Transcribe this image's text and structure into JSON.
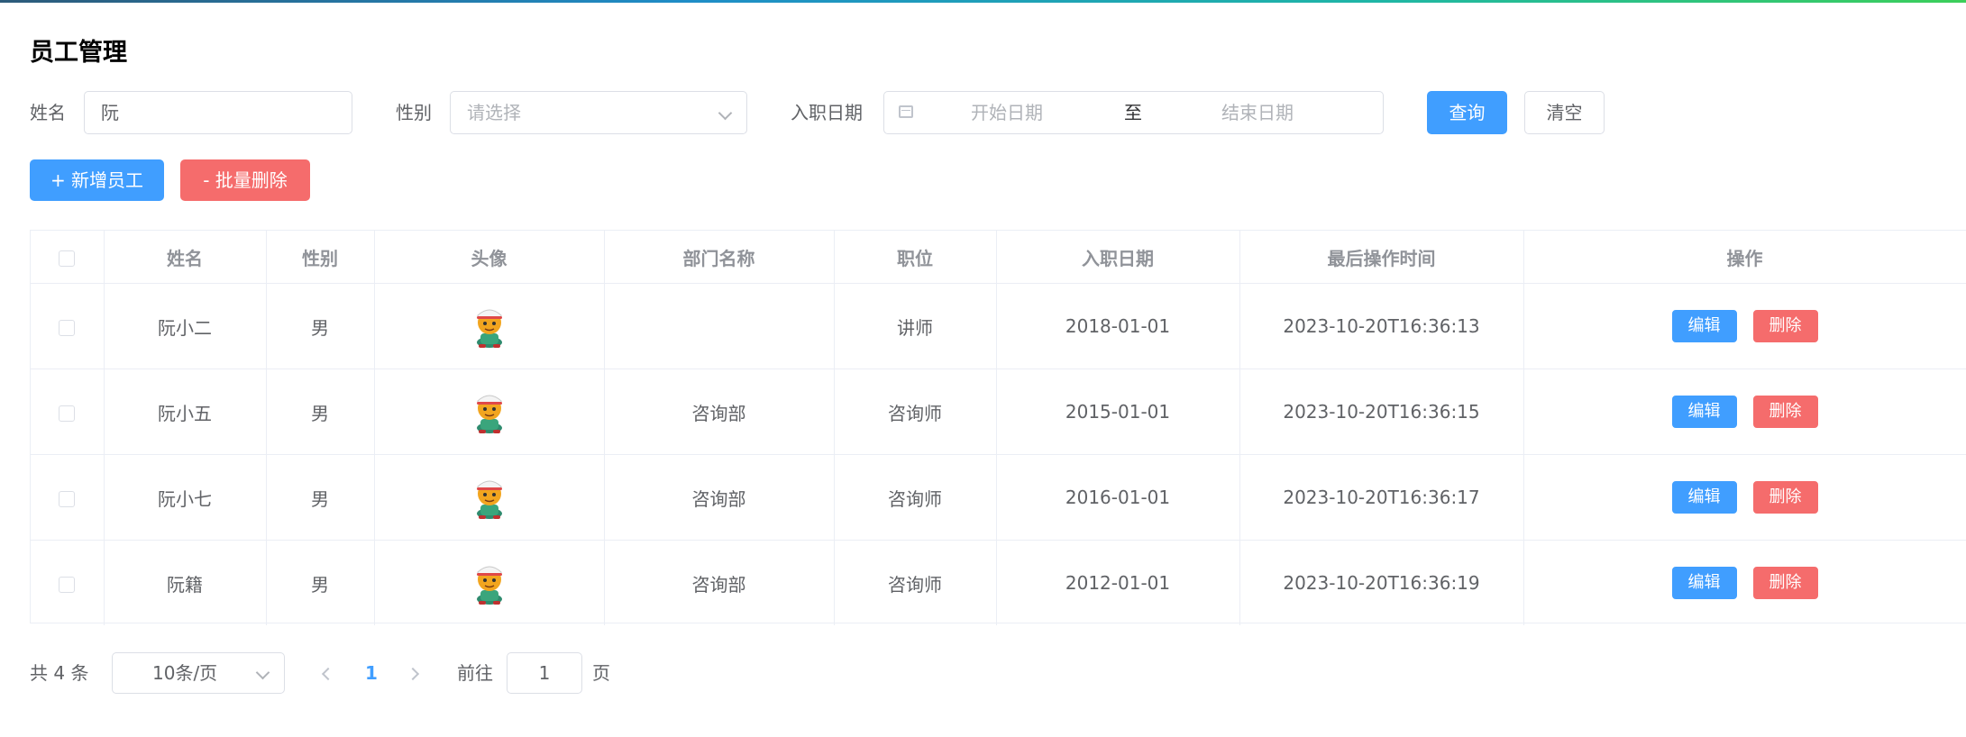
{
  "page": {
    "title": "员工管理"
  },
  "search": {
    "name_label": "姓名",
    "name_value": "阮",
    "gender_label": "性别",
    "gender_placeholder": "请选择",
    "date_label": "入职日期",
    "start_placeholder": "开始日期",
    "range_separator": "至",
    "end_placeholder": "结束日期",
    "query_button": "查询",
    "clear_button": "清空"
  },
  "actions": {
    "add_button": "+ 新增员工",
    "batch_delete_button": "- 批量删除"
  },
  "table": {
    "columns": [
      "姓名",
      "性别",
      "头像",
      "部门名称",
      "职位",
      "入职日期",
      "最后操作时间",
      "操作"
    ],
    "rows": [
      {
        "name": "阮小二",
        "gender": "男",
        "avatar": "cartoon-avatar-icon",
        "dept": "",
        "job": "讲师",
        "entry_date": "2018-01-01",
        "update_time": "2023-10-20T16:36:13"
      },
      {
        "name": "阮小五",
        "gender": "男",
        "avatar": "cartoon-avatar-icon",
        "dept": "咨询部",
        "job": "咨询师",
        "entry_date": "2015-01-01",
        "update_time": "2023-10-20T16:36:15"
      },
      {
        "name": "阮小七",
        "gender": "男",
        "avatar": "cartoon-avatar-icon",
        "dept": "咨询部",
        "job": "咨询师",
        "entry_date": "2016-01-01",
        "update_time": "2023-10-20T16:36:17"
      },
      {
        "name": "阮籍",
        "gender": "男",
        "avatar": "cartoon-avatar-icon",
        "dept": "咨询部",
        "job": "咨询师",
        "entry_date": "2012-01-01",
        "update_time": "2023-10-20T16:36:19"
      }
    ],
    "edit_label": "编辑",
    "delete_label": "删除"
  },
  "pagination": {
    "total_text": "共 4 条",
    "page_size": "10条/页",
    "current_page": "1",
    "goto_label": "前往",
    "goto_value": "1",
    "page_suffix": "页"
  },
  "colors": {
    "primary": "#409eff",
    "danger": "#f56c6c",
    "border": "#dcdfe6",
    "header_text": "#909399"
  }
}
